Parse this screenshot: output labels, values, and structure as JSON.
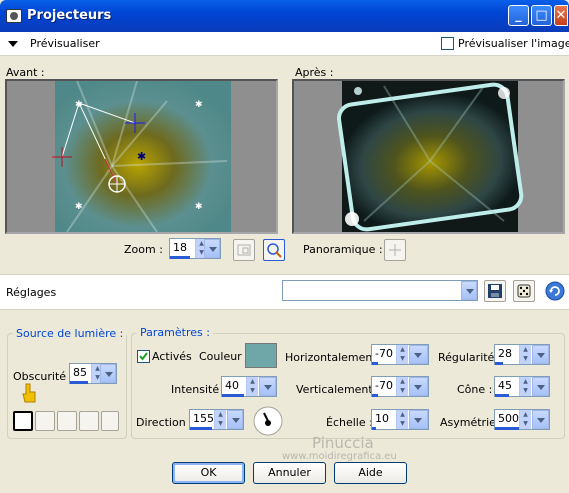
{
  "window": {
    "title": "Projecteurs",
    "min": "_",
    "max": "□",
    "close": "✕"
  },
  "preview_header": {
    "label": "Prévisualiser",
    "checkbox_label": "Prévisualiser l'image"
  },
  "avant": {
    "label": "Avant :"
  },
  "apres": {
    "label": "Après :"
  },
  "zoom": {
    "label": "Zoom :",
    "value": "18"
  },
  "panoramique": {
    "label": "Panoramique :"
  },
  "reglages": {
    "label": "Réglages",
    "value": ""
  },
  "source": {
    "legend": "Source de lumière :",
    "obscurite_label": "Obscurité :",
    "obscurite_value": "85"
  },
  "params": {
    "legend": "Paramètres :",
    "actives_label": "Activés",
    "couleur_label": "Couleur :",
    "couleur_hex": "#6FA6A8",
    "horizontal_label": "Horizontalement :",
    "horizontal_value": "-70",
    "regularite_label": "Régularité :",
    "regularite_value": "28",
    "intensite_label": "Intensité :",
    "intensite_value": "40",
    "vertical_label": "Verticalement :",
    "vertical_value": "-70",
    "cone_label": "Cône :",
    "cone_value": "45",
    "direction_label": "Direction :",
    "direction_value": "155",
    "echelle_label": "Échelle :",
    "echelle_value": "10",
    "asymetrie_label": "Asymétrie :",
    "asymetrie_value": "500"
  },
  "buttons": {
    "ok": "OK",
    "annuler": "Annuler",
    "aide": "Aide"
  },
  "watermark": {
    "line1": "Pinuccia",
    "line2": "www.moidiregrafica.eu"
  }
}
